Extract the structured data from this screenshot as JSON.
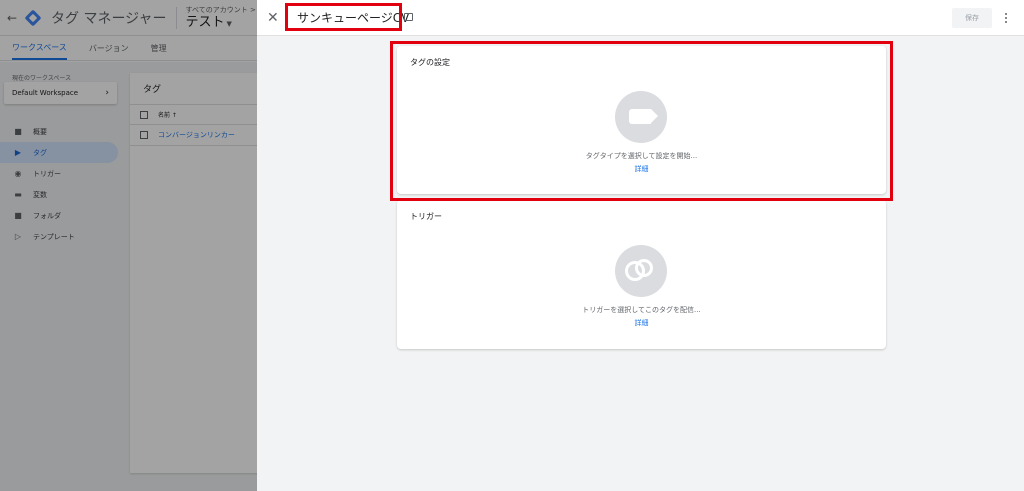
{
  "app": {
    "product_name": "タグ マネージャー",
    "account_path": "すべてのアカウント > テスト",
    "container_name": "テスト",
    "tabs": [
      {
        "label": "ワークスペース",
        "active": true
      },
      {
        "label": "バージョン",
        "active": false
      },
      {
        "label": "管理",
        "active": false
      }
    ],
    "workspace_label": "現在のワークスペース",
    "workspace_name": "Default Workspace",
    "nav": [
      {
        "label": "概要",
        "icon": "briefcase-icon",
        "active": false
      },
      {
        "label": "タグ",
        "icon": "tag-icon",
        "active": true
      },
      {
        "label": "トリガー",
        "icon": "trigger-icon",
        "active": false
      },
      {
        "label": "変数",
        "icon": "variables-icon",
        "active": false
      },
      {
        "label": "フォルダ",
        "icon": "folder-icon",
        "active": false
      },
      {
        "label": "テンプレート",
        "icon": "template-icon",
        "active": false
      }
    ],
    "tag_list": {
      "title": "タグ",
      "column_name": "名前 ↑",
      "rows": [
        "コンバージョンリンカー"
      ]
    }
  },
  "panel": {
    "title": "サンキューページCV",
    "save_label": "保存",
    "tag_section": {
      "title": "タグの設定",
      "hint": "タグタイプを選択して設定を開始...",
      "link": "詳細"
    },
    "trigger_section": {
      "title": "トリガー",
      "hint": "トリガーを選択してこのタグを配信...",
      "link": "詳細"
    }
  },
  "colors": {
    "accent": "#1a73e8",
    "highlight": "#e2000f",
    "nav_active_bg": "#d2e3fc",
    "icon_circle": "#dadce0"
  }
}
